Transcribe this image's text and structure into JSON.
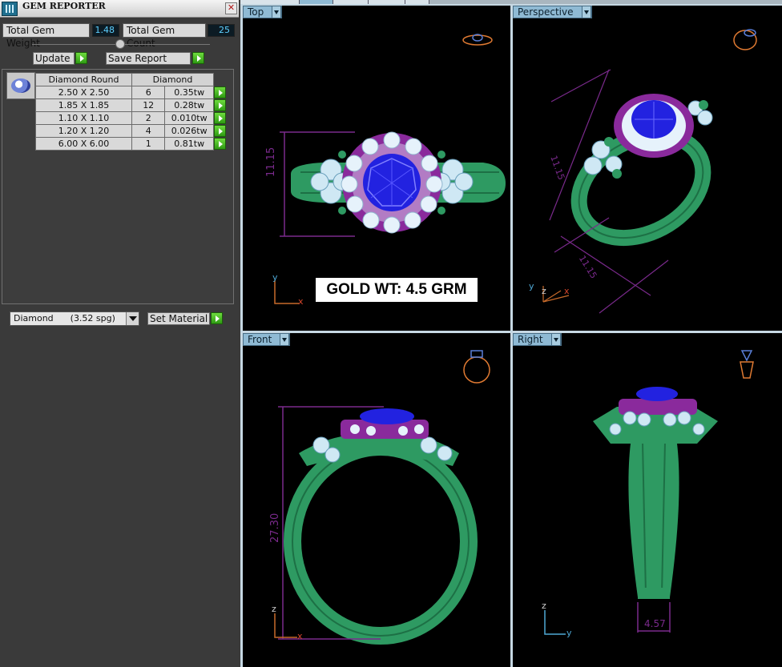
{
  "panel": {
    "title": "GEM REPORTER",
    "close_glyph": "✕",
    "total_weight_label": "Total Gem Weight",
    "total_weight_value": "1.48",
    "total_count_label": "Total Gem Count",
    "total_count_value": "25",
    "update_label": "Update",
    "save_report_label": "Save Report"
  },
  "gem_table": {
    "header": [
      "Diamond Round",
      "Diamond"
    ],
    "rows": [
      {
        "size": "2.50 X 2.50",
        "count": "6",
        "weight": "0.35tw"
      },
      {
        "size": "1.85 X 1.85",
        "count": "12",
        "weight": "0.28tw"
      },
      {
        "size": "1.10 X 1.10",
        "count": "2",
        "weight": "0.010tw"
      },
      {
        "size": "1.20 X 1.20",
        "count": "4",
        "weight": "0.026tw"
      },
      {
        "size": "6.00 X 6.00",
        "count": "1",
        "weight": "0.81tw"
      }
    ]
  },
  "material": {
    "selected": "Diamond      (3.52 spg)",
    "set_label": "Set Material"
  },
  "viewports": {
    "top": {
      "label": "Top",
      "dimension": "11.15",
      "axis_y": "y",
      "axis_x": "x"
    },
    "perspective": {
      "label": "Perspective",
      "dimension_a": "11.15",
      "dimension_b": "11.15",
      "axis_y": "y",
      "axis_z": "z",
      "axis_x": "x"
    },
    "front": {
      "label": "Front",
      "dimension": "27.30",
      "axis_z": "z",
      "axis_x": "x"
    },
    "right": {
      "label": "Right",
      "dimension": "4.57",
      "axis_z": "z",
      "axis_y": "y"
    }
  },
  "annotation": {
    "gold_weight": "GOLD WT: 4.5 GRM"
  },
  "colors": {
    "metal": "#2e9a62",
    "center_stone": "#2222e0",
    "halo": "#8a2a9c",
    "accent_stone": "#cfe8f4",
    "dimension": "#7a2a8c",
    "viewport_label": "#8fbad4"
  },
  "icons": [
    "app-icon",
    "close-icon",
    "gem-thumbnail-icon",
    "go-arrow-icon",
    "dropdown-icon",
    "ring-view-icon",
    "axis-icon"
  ]
}
